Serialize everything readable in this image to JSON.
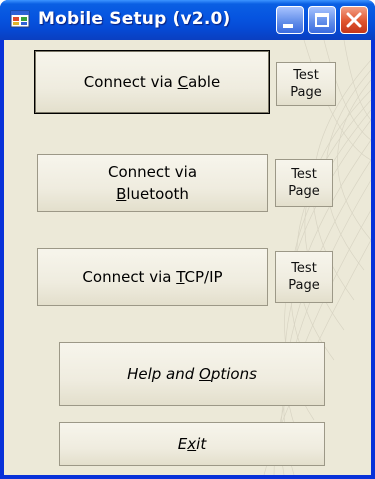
{
  "window": {
    "title": "Mobile Setup (v2.0)",
    "app_icon": "application-icon",
    "controls": [
      "minimize-icon",
      "maximize-icon",
      "close-icon"
    ]
  },
  "buttons": {
    "cable": {
      "pre": "Connect via ",
      "mnemonic": "C",
      "post": "able"
    },
    "bluetooth": {
      "line1": "Connect via",
      "mnemonic": "B",
      "post": "luetooth"
    },
    "tcp": {
      "pre": "Connect via ",
      "mnemonic": "T",
      "post": "CP/IP"
    },
    "test_line1": "Test",
    "test_line2": "Page",
    "help": {
      "pre": "Help and ",
      "mnemonic": "O",
      "post": "ptions"
    },
    "exit": {
      "pre": "E",
      "mnemonic": "x",
      "post": "it"
    }
  },
  "colors": {
    "titlebar": "#0654e0",
    "client_bg": "#ece9d8",
    "close_button": "#e0552e"
  }
}
